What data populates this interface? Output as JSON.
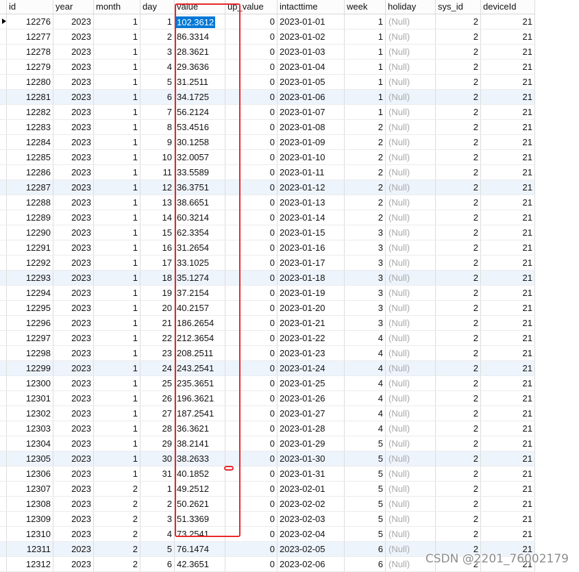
{
  "grid": {
    "columns": [
      "id",
      "year",
      "month",
      "day",
      "value",
      "up_value",
      "intacttime",
      "week",
      "holiday",
      "sys_id",
      "deviceId"
    ],
    "null_text": "(Null)",
    "current_row_id": 12276,
    "selected_cell": {
      "row_id": 12276,
      "column": "value"
    },
    "rows": [
      {
        "id": 12276,
        "year": 2023,
        "month": 1,
        "day": 1,
        "value": "102.3612",
        "up_value": 0,
        "intacttime": "2023-01-01",
        "week": 1,
        "holiday": null,
        "sys_id": 2,
        "deviceId": 21
      },
      {
        "id": 12277,
        "year": 2023,
        "month": 1,
        "day": 2,
        "value": "86.3314",
        "up_value": 0,
        "intacttime": "2023-01-02",
        "week": 1,
        "holiday": null,
        "sys_id": 2,
        "deviceId": 21
      },
      {
        "id": 12278,
        "year": 2023,
        "month": 1,
        "day": 3,
        "value": "28.3621",
        "up_value": 0,
        "intacttime": "2023-01-03",
        "week": 1,
        "holiday": null,
        "sys_id": 2,
        "deviceId": 21
      },
      {
        "id": 12279,
        "year": 2023,
        "month": 1,
        "day": 4,
        "value": "29.3636",
        "up_value": 0,
        "intacttime": "2023-01-04",
        "week": 1,
        "holiday": null,
        "sys_id": 2,
        "deviceId": 21
      },
      {
        "id": 12280,
        "year": 2023,
        "month": 1,
        "day": 5,
        "value": "31.2511",
        "up_value": 0,
        "intacttime": "2023-01-05",
        "week": 1,
        "holiday": null,
        "sys_id": 2,
        "deviceId": 21
      },
      {
        "id": 12281,
        "year": 2023,
        "month": 1,
        "day": 6,
        "value": "34.1725",
        "up_value": 0,
        "intacttime": "2023-01-06",
        "week": 1,
        "holiday": null,
        "sys_id": 2,
        "deviceId": 21
      },
      {
        "id": 12282,
        "year": 2023,
        "month": 1,
        "day": 7,
        "value": "56.2124",
        "up_value": 0,
        "intacttime": "2023-01-07",
        "week": 1,
        "holiday": null,
        "sys_id": 2,
        "deviceId": 21
      },
      {
        "id": 12283,
        "year": 2023,
        "month": 1,
        "day": 8,
        "value": "53.4516",
        "up_value": 0,
        "intacttime": "2023-01-08",
        "week": 2,
        "holiday": null,
        "sys_id": 2,
        "deviceId": 21
      },
      {
        "id": 12284,
        "year": 2023,
        "month": 1,
        "day": 9,
        "value": "30.1258",
        "up_value": 0,
        "intacttime": "2023-01-09",
        "week": 2,
        "holiday": null,
        "sys_id": 2,
        "deviceId": 21
      },
      {
        "id": 12285,
        "year": 2023,
        "month": 1,
        "day": 10,
        "value": "32.0057",
        "up_value": 0,
        "intacttime": "2023-01-10",
        "week": 2,
        "holiday": null,
        "sys_id": 2,
        "deviceId": 21
      },
      {
        "id": 12286,
        "year": 2023,
        "month": 1,
        "day": 11,
        "value": "33.5589",
        "up_value": 0,
        "intacttime": "2023-01-11",
        "week": 2,
        "holiday": null,
        "sys_id": 2,
        "deviceId": 21
      },
      {
        "id": 12287,
        "year": 2023,
        "month": 1,
        "day": 12,
        "value": "36.3751",
        "up_value": 0,
        "intacttime": "2023-01-12",
        "week": 2,
        "holiday": null,
        "sys_id": 2,
        "deviceId": 21
      },
      {
        "id": 12288,
        "year": 2023,
        "month": 1,
        "day": 13,
        "value": "38.6651",
        "up_value": 0,
        "intacttime": "2023-01-13",
        "week": 2,
        "holiday": null,
        "sys_id": 2,
        "deviceId": 21
      },
      {
        "id": 12289,
        "year": 2023,
        "month": 1,
        "day": 14,
        "value": "60.3214",
        "up_value": 0,
        "intacttime": "2023-01-14",
        "week": 2,
        "holiday": null,
        "sys_id": 2,
        "deviceId": 21
      },
      {
        "id": 12290,
        "year": 2023,
        "month": 1,
        "day": 15,
        "value": "62.3354",
        "up_value": 0,
        "intacttime": "2023-01-15",
        "week": 3,
        "holiday": null,
        "sys_id": 2,
        "deviceId": 21
      },
      {
        "id": 12291,
        "year": 2023,
        "month": 1,
        "day": 16,
        "value": "31.2654",
        "up_value": 0,
        "intacttime": "2023-01-16",
        "week": 3,
        "holiday": null,
        "sys_id": 2,
        "deviceId": 21
      },
      {
        "id": 12292,
        "year": 2023,
        "month": 1,
        "day": 17,
        "value": "33.1025",
        "up_value": 0,
        "intacttime": "2023-01-17",
        "week": 3,
        "holiday": null,
        "sys_id": 2,
        "deviceId": 21
      },
      {
        "id": 12293,
        "year": 2023,
        "month": 1,
        "day": 18,
        "value": "35.1274",
        "up_value": 0,
        "intacttime": "2023-01-18",
        "week": 3,
        "holiday": null,
        "sys_id": 2,
        "deviceId": 21
      },
      {
        "id": 12294,
        "year": 2023,
        "month": 1,
        "day": 19,
        "value": "37.2154",
        "up_value": 0,
        "intacttime": "2023-01-19",
        "week": 3,
        "holiday": null,
        "sys_id": 2,
        "deviceId": 21
      },
      {
        "id": 12295,
        "year": 2023,
        "month": 1,
        "day": 20,
        "value": "40.2157",
        "up_value": 0,
        "intacttime": "2023-01-20",
        "week": 3,
        "holiday": null,
        "sys_id": 2,
        "deviceId": 21
      },
      {
        "id": 12296,
        "year": 2023,
        "month": 1,
        "day": 21,
        "value": "186.2654",
        "up_value": 0,
        "intacttime": "2023-01-21",
        "week": 3,
        "holiday": null,
        "sys_id": 2,
        "deviceId": 21
      },
      {
        "id": 12297,
        "year": 2023,
        "month": 1,
        "day": 22,
        "value": "212.3654",
        "up_value": 0,
        "intacttime": "2023-01-22",
        "week": 4,
        "holiday": null,
        "sys_id": 2,
        "deviceId": 21
      },
      {
        "id": 12298,
        "year": 2023,
        "month": 1,
        "day": 23,
        "value": "208.2511",
        "up_value": 0,
        "intacttime": "2023-01-23",
        "week": 4,
        "holiday": null,
        "sys_id": 2,
        "deviceId": 21
      },
      {
        "id": 12299,
        "year": 2023,
        "month": 1,
        "day": 24,
        "value": "243.2541",
        "up_value": 0,
        "intacttime": "2023-01-24",
        "week": 4,
        "holiday": null,
        "sys_id": 2,
        "deviceId": 21
      },
      {
        "id": 12300,
        "year": 2023,
        "month": 1,
        "day": 25,
        "value": "235.3651",
        "up_value": 0,
        "intacttime": "2023-01-25",
        "week": 4,
        "holiday": null,
        "sys_id": 2,
        "deviceId": 21
      },
      {
        "id": 12301,
        "year": 2023,
        "month": 1,
        "day": 26,
        "value": "196.3621",
        "up_value": 0,
        "intacttime": "2023-01-26",
        "week": 4,
        "holiday": null,
        "sys_id": 2,
        "deviceId": 21
      },
      {
        "id": 12302,
        "year": 2023,
        "month": 1,
        "day": 27,
        "value": "187.2541",
        "up_value": 0,
        "intacttime": "2023-01-27",
        "week": 4,
        "holiday": null,
        "sys_id": 2,
        "deviceId": 21
      },
      {
        "id": 12303,
        "year": 2023,
        "month": 1,
        "day": 28,
        "value": "36.3621",
        "up_value": 0,
        "intacttime": "2023-01-28",
        "week": 4,
        "holiday": null,
        "sys_id": 2,
        "deviceId": 21
      },
      {
        "id": 12304,
        "year": 2023,
        "month": 1,
        "day": 29,
        "value": "38.2141",
        "up_value": 0,
        "intacttime": "2023-01-29",
        "week": 5,
        "holiday": null,
        "sys_id": 2,
        "deviceId": 21
      },
      {
        "id": 12305,
        "year": 2023,
        "month": 1,
        "day": 30,
        "value": "38.2633",
        "up_value": 0,
        "intacttime": "2023-01-30",
        "week": 5,
        "holiday": null,
        "sys_id": 2,
        "deviceId": 21
      },
      {
        "id": 12306,
        "year": 2023,
        "month": 1,
        "day": 31,
        "value": "40.1852",
        "up_value": 0,
        "intacttime": "2023-01-31",
        "week": 5,
        "holiday": null,
        "sys_id": 2,
        "deviceId": 21
      },
      {
        "id": 12307,
        "year": 2023,
        "month": 2,
        "day": 1,
        "value": "49.2512",
        "up_value": 0,
        "intacttime": "2023-02-01",
        "week": 5,
        "holiday": null,
        "sys_id": 2,
        "deviceId": 21
      },
      {
        "id": 12308,
        "year": 2023,
        "month": 2,
        "day": 2,
        "value": "50.2621",
        "up_value": 0,
        "intacttime": "2023-02-02",
        "week": 5,
        "holiday": null,
        "sys_id": 2,
        "deviceId": 21
      },
      {
        "id": 12309,
        "year": 2023,
        "month": 2,
        "day": 3,
        "value": "51.3369",
        "up_value": 0,
        "intacttime": "2023-02-03",
        "week": 5,
        "holiday": null,
        "sys_id": 2,
        "deviceId": 21
      },
      {
        "id": 12310,
        "year": 2023,
        "month": 2,
        "day": 4,
        "value": "73.2541",
        "up_value": 0,
        "intacttime": "2023-02-04",
        "week": 5,
        "holiday": null,
        "sys_id": 2,
        "deviceId": 21
      },
      {
        "id": 12311,
        "year": 2023,
        "month": 2,
        "day": 5,
        "value": "76.1474",
        "up_value": 0,
        "intacttime": "2023-02-05",
        "week": 6,
        "holiday": null,
        "sys_id": 2,
        "deviceId": 21
      },
      {
        "id": 12312,
        "year": 2023,
        "month": 2,
        "day": 6,
        "value": "42.3651",
        "up_value": 0,
        "intacttime": "2023-02-06",
        "week": 6,
        "holiday": null,
        "sys_id": 2,
        "deviceId": 21
      }
    ]
  },
  "icons": {
    "current_row": "current-row-arrow-icon"
  },
  "watermark": {
    "text": "CSDN @2201_76002179"
  },
  "colors": {
    "selection": "#0078d7",
    "annotation": "#e8262a",
    "null_text": "#a8a8a8",
    "watermark": "#8d8d8d",
    "row_stripe": "#eef4fc"
  }
}
